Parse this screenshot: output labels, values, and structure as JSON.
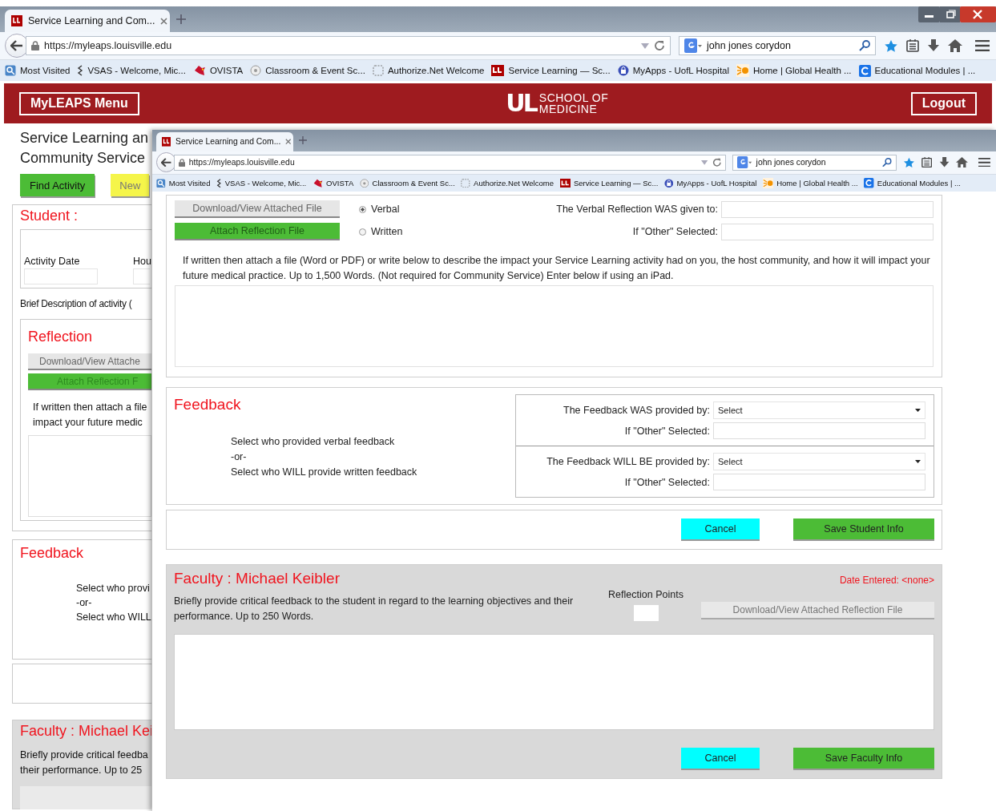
{
  "browser": {
    "tab_title": "Service Learning and Com...",
    "url": "https://myleaps.louisville.edu",
    "search": "john jones corydon",
    "bookmarks": [
      {
        "label": "Most Visited",
        "kind": "magnifier"
      },
      {
        "label": "VSAS - Welcome, Mic...",
        "kind": "squiggle"
      },
      {
        "label": "OVISTA",
        "kind": "bird"
      },
      {
        "label": "Classroom & Event Sc...",
        "kind": "disc"
      },
      {
        "label": "Authorize.Net Welcome",
        "kind": "dashed"
      },
      {
        "label": "Service Learning — Sc...",
        "kind": "square"
      },
      {
        "label": "MyApps - UofL Hospital",
        "kind": "lock"
      },
      {
        "label": "Home | Global Health ...",
        "kind": "sun"
      },
      {
        "label": "Educational Modules | ...",
        "kind": "ring"
      }
    ]
  },
  "header": {
    "menu_button": "MyLEAPS Menu",
    "logo_letters": "UL",
    "logo_line_1": "SCHOOL OF",
    "logo_line_2": "MEDICINE",
    "logout_button": "Logout"
  },
  "page": {
    "title_lines": [
      "Service Learning an",
      "Community Service"
    ],
    "buttons": [
      {
        "label": "Find Activity",
        "kind": "find"
      },
      {
        "label": "New",
        "kind": "new"
      }
    ],
    "student_heading": "Student :",
    "activity_date_label": "Activity Date",
    "hours_label": "Hou",
    "brief_description_label": "Brief Description of activity (",
    "reflection_heading": "Reflection",
    "download_button": "Download/View Attache",
    "attach_button": "Attach Reflection F",
    "reflection_text_lines": [
      "If written then attach a file",
      "impact your future medic"
    ],
    "feedback_heading": "Feedback",
    "feedback_lines": [
      "Select who provi",
      "-or-",
      "Select who WILL"
    ],
    "faculty_heading": "Faculty : Michael Kei",
    "faculty_text_lines": [
      "Briefly provide critical feedba",
      "their performance. Up to 25"
    ]
  },
  "overlay": {
    "browser": {
      "tab_title": "Service Learning and Com...",
      "url": "https://myleaps.louisville.edu",
      "search": "john jones corydon",
      "bookmarks": [
        {
          "label": "Most Visited",
          "kind": "magnifier"
        },
        {
          "label": "VSAS - Welcome, Mic...",
          "kind": "squiggle"
        },
        {
          "label": "OVISTA",
          "kind": "bird"
        },
        {
          "label": "Classroom & Event Sc...",
          "kind": "disc"
        },
        {
          "label": "Authorize.Net Welcome",
          "kind": "dashed"
        },
        {
          "label": "Service Learning — Sc...",
          "kind": "square"
        },
        {
          "label": "MyApps - UofL Hospital",
          "kind": "lock"
        },
        {
          "label": "Home | Global Health ...",
          "kind": "sun"
        },
        {
          "label": "Educational Modules | ...",
          "kind": "ring"
        }
      ]
    },
    "reflection": {
      "download_button": {
        "label": "Download/View Attached File",
        "disabled": true
      },
      "attach_button": {
        "label": "Attach Reflection File",
        "disabled": true
      },
      "radios": [
        {
          "label": "Verbal",
          "selected": true
        },
        {
          "label": "Written",
          "selected": false
        }
      ],
      "given_to_label": "The Verbal Reflection WAS given to:",
      "other_label": "If \"Other\" Selected:",
      "instructions": "If written then attach a file (Word or PDF) or write below to describe the impact your Service Learning activity had on you, the host community, and how it will impact your future medical practice. Up to 1,500 Words. (Not required for Community Service) Enter below if using an iPad."
    },
    "feedback": {
      "heading": "Feedback",
      "instruction_lines": [
        "Select who provided verbal feedback",
        "-or-",
        "Select who WILL provide written feedback"
      ],
      "groups": [
        {
          "label": "The Feedback WAS provided by:",
          "value": "Select",
          "other_label": "If \"Other\" Selected:"
        },
        {
          "label": "The Feedback WILL BE provided by:",
          "value": "Select",
          "other_label": "If \"Other\" Selected:"
        }
      ]
    },
    "student_actions": [
      {
        "label": "Cancel",
        "kind": "cancel"
      },
      {
        "label": "Save Student Info",
        "kind": "save"
      }
    ],
    "faculty": {
      "heading": "Faculty : Michael Keibler",
      "date_entered": "Date Entered: <none>",
      "instructions": "Briefly provide critical feedback to the student in regard to the learning objectives and their performance. Up to 250 Words.",
      "points_label": "Reflection Points",
      "download_button": {
        "label": "Download/View Attached Reflection File",
        "disabled": true
      },
      "actions": [
        {
          "label": "Cancel",
          "kind": "cancel"
        },
        {
          "label": "Save Faculty Info",
          "kind": "save"
        }
      ]
    }
  }
}
